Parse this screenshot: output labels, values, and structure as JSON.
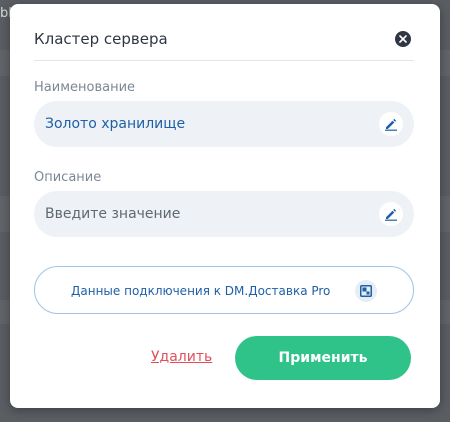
{
  "background": {
    "corner_text": "bl"
  },
  "dialog": {
    "title": "Кластер сервера",
    "fields": {
      "name": {
        "label": "Наименование",
        "value": "Золото хранилище"
      },
      "description": {
        "label": "Описание",
        "placeholder": "Введите значение"
      }
    },
    "connection_button": {
      "label": "Данные подключения к DM.Доставка Pro"
    },
    "actions": {
      "delete_label": "Удалить",
      "apply_label": "Применить"
    }
  },
  "colors": {
    "primary_text": "#2f3742",
    "link_blue": "#1f5fa8",
    "apply_green": "#2fc38a",
    "delete_red": "#e0505a",
    "field_bg": "#eef2f6"
  },
  "icons": [
    "close-icon",
    "pencil-icon",
    "pencil-icon",
    "window-expand-icon"
  ]
}
